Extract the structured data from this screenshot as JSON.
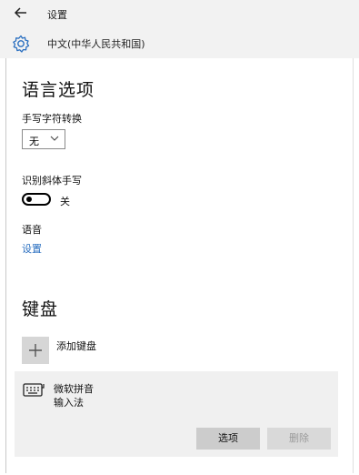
{
  "window": {
    "title": "设置"
  },
  "header": {
    "language_name": "中文(中华人民共和国)"
  },
  "page": {
    "heading": "语言选项"
  },
  "handwriting": {
    "conversion_label": "手写字符转换",
    "conversion_value": "无",
    "italic_label": "识别斜体手写",
    "italic_toggle_state": "关",
    "italic_toggle_on": false
  },
  "speech": {
    "label": "语音",
    "settings_link": "设置"
  },
  "keyboard": {
    "heading": "键盘",
    "add_label": "添加键盘",
    "installed": [
      {
        "name": "微软拼音",
        "type": "输入法",
        "options_label": "选项",
        "remove_label": "删除"
      }
    ]
  },
  "colors": {
    "link": "#2a6fc0",
    "header_bg": "#f2f2f2",
    "panel_bg": "#f0f0f0",
    "button_bg": "#cccccc"
  },
  "icons": {
    "back": "back-arrow-icon",
    "settings": "gear-icon",
    "dropdown": "chevron-down-icon",
    "add": "plus-icon",
    "keyboard": "keyboard-icon"
  }
}
